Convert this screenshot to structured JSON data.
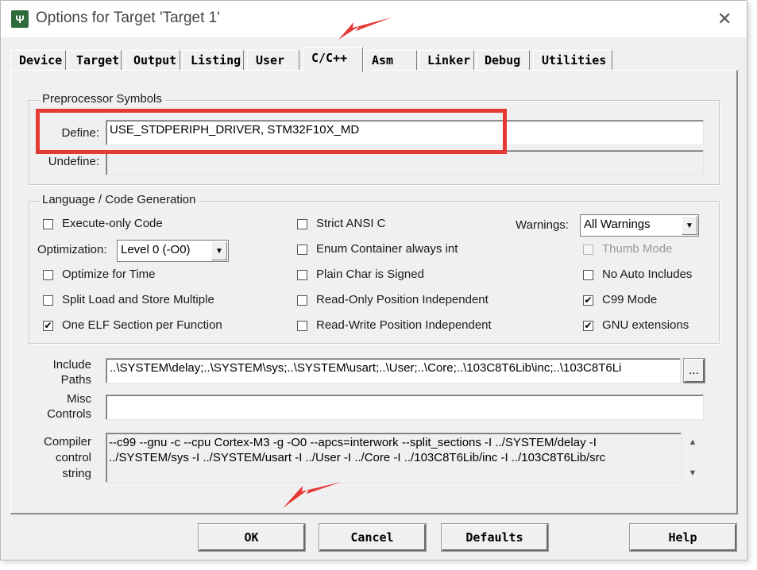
{
  "window": {
    "title": "Options for Target 'Target 1'",
    "app_icon_glyph": "Ψ",
    "close_glyph": "✕"
  },
  "tabs": [
    {
      "label": "Device"
    },
    {
      "label": "Target"
    },
    {
      "label": "Output"
    },
    {
      "label": "Listing"
    },
    {
      "label": "User"
    },
    {
      "label": "C/C++",
      "active": true
    },
    {
      "label": "Asm"
    },
    {
      "label": "Linker"
    },
    {
      "label": "Debug"
    },
    {
      "label": "Utilities"
    }
  ],
  "preprocessor": {
    "group_title": "Preprocessor Symbols",
    "define_label": "Define:",
    "define_value": "USE_STDPERIPH_DRIVER, STM32F10X_MD",
    "undefine_label": "Undefine:",
    "undefine_value": ""
  },
  "language": {
    "group_title": "Language / Code Generation",
    "execute_only": {
      "label": "Execute-only Code",
      "checked": false
    },
    "optimization_label": "Optimization:",
    "optimization_value": "Level 0 (-O0)",
    "optimize_time": {
      "label": "Optimize for Time",
      "checked": false
    },
    "split_load": {
      "label": "Split Load and Store Multiple",
      "checked": false
    },
    "one_elf": {
      "label": "One ELF Section per Function",
      "checked": true
    },
    "strict_ansi": {
      "label": "Strict ANSI C",
      "checked": false
    },
    "enum_container": {
      "label": "Enum Container always int",
      "checked": false
    },
    "plain_char": {
      "label": "Plain Char is Signed",
      "checked": false
    },
    "ro_pos": {
      "label": "Read-Only Position Independent",
      "checked": false
    },
    "rw_pos": {
      "label": "Read-Write Position Independent",
      "checked": false
    },
    "warnings_label": "Warnings:",
    "warnings_value": "All Warnings",
    "thumb_mode": {
      "label": "Thumb Mode",
      "checked": false,
      "disabled": true
    },
    "no_auto_includes": {
      "label": "No Auto Includes",
      "checked": false
    },
    "c99_mode": {
      "label": "C99 Mode",
      "checked": true
    },
    "gnu_ext": {
      "label": "GNU extensions",
      "checked": true
    }
  },
  "paths": {
    "include_label_1": "Include",
    "include_label_2": "Paths",
    "include_value": "..\\SYSTEM\\delay;..\\SYSTEM\\sys;..\\SYSTEM\\usart;..\\User;..\\Core;..\\103C8T6Lib\\inc;..\\103C8T6Li",
    "browse_label": "...",
    "misc_label_1": "Misc",
    "misc_label_2": "Controls",
    "misc_value": "",
    "compiler_label_1": "Compiler",
    "compiler_label_2": "control",
    "compiler_label_3": "string",
    "compiler_value": "--c99 --gnu -c --cpu Cortex-M3 -g -O0 --apcs=interwork --split_sections -I ../SYSTEM/delay -I ../SYSTEM/sys -I ../SYSTEM/usart -I ../User -I ../Core -I ../103C8T6Lib/inc -I ../103C8T6Lib/src",
    "scroll_up_glyph": "▲",
    "scroll_down_glyph": "▼"
  },
  "buttons": {
    "ok": "OK",
    "cancel": "Cancel",
    "defaults": "Defaults",
    "help": "Help"
  },
  "checkmark_glyph": "✔",
  "combo_arrow_glyph": "▼",
  "annotation_color": "#e53935"
}
